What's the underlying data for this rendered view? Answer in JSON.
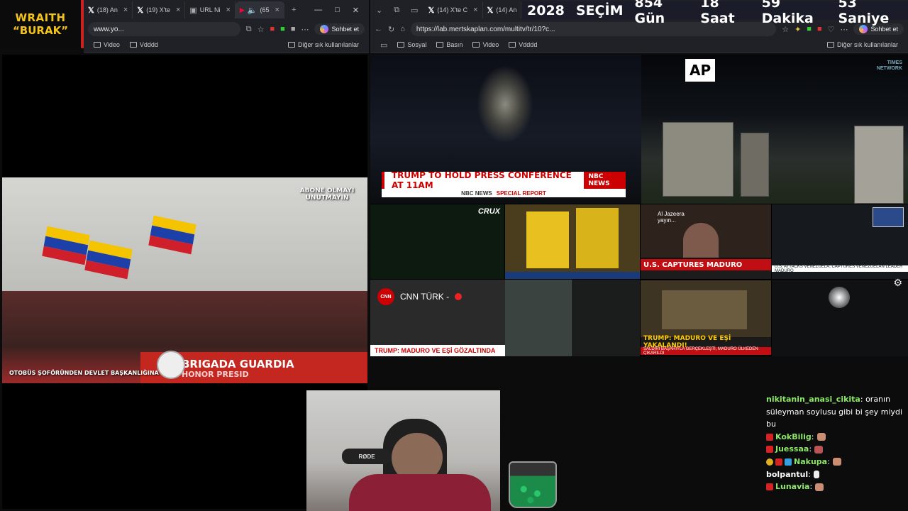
{
  "logo": {
    "line1": "WRAITH",
    "line2": "“BURAK”"
  },
  "left_browser": {
    "tabs": [
      {
        "label": "(18) An"
      },
      {
        "label": "(19) X'te"
      },
      {
        "label": "URL Ni"
      },
      {
        "label": "(65"
      }
    ],
    "url": "www.yo...",
    "copilot": "Sohbet et",
    "bookmarks": [
      "Video",
      "Vdddd"
    ],
    "bookmarks_other": "Diğer sık kullanılanlar"
  },
  "right_browser": {
    "tabs": [
      {
        "label": "(14) X'te C"
      },
      {
        "label": "(14) An"
      }
    ],
    "url": "https://lab.mertskaplan.com/multitv/tr/10?c...",
    "copilot": "Sohbet et",
    "bookmarks": [
      "Sosyal",
      "Basın",
      "Video",
      "Vdddd"
    ],
    "bookmarks_other": "Diğer sık kullanılanlar"
  },
  "countdown": [
    "2028",
    "SEÇİM",
    "854 Gün",
    "18 Saat",
    "59 Dakika",
    "53 Saniye"
  ],
  "left_video": {
    "subtitle_top": "ABONE OLMAYI UNUTMAYIN",
    "subtitle_bottom": "OTOBÜS ŞOFÖRÜNDEN DEVLET BAŞKANLIĞINA",
    "banner_line1": "BRIGADA GUARDIA",
    "banner_line2": "HONOR PRESID"
  },
  "grid": {
    "nbc_headline": "TRUMP TO HOLD PRESS CONFERENCE AT 11AM",
    "nbc_brand": "NBC NEWS",
    "nbc_strip": "NBC NEWS",
    "nbc_special": "SPECIAL REPORT",
    "ap_logo": "AP",
    "times_network": "TIMES NETWORK",
    "crux_label": "CRUX",
    "aj_caption": "Al Jazeera yayın...",
    "captures_headline": "U.S. CAPTURES MADURO",
    "venezuela_strip": "U.S. ATTACKS VENEZUELA, CAPTURES VENEZUELAN LEADER MADURO",
    "cnn_turk": "CNN TÜRK -",
    "cnn_turk_bar": "TRUMP: MADURO VE EŞİ GÖZALTINDA",
    "sozcu_headline": "TRUMP: MADURO VE EŞİ YAKALANDI!",
    "sozcu_sub": "SALDIRI BAŞARIYLA GERÇEKLEŞTİ, MADURO ÜLKEDEN ÇIKARILDI"
  },
  "webcam": {
    "mic_label": "RØDE"
  },
  "chat": [
    {
      "user": "nikitanin_anasi_cikita",
      "text": "oranın süleyman soylusu gibi bi şey miydi bu",
      "badges": []
    },
    {
      "user": "KokBilig",
      "text": "",
      "badges": [
        "red"
      ]
    },
    {
      "user": "Juessaa",
      "text": "",
      "badges": [
        "red"
      ]
    },
    {
      "user": "Nakupa",
      "text": "",
      "badges": [
        "gold",
        "red",
        "blue"
      ]
    },
    {
      "user": "bolpantul",
      "text": "",
      "badges": []
    },
    {
      "user": "Lunavia",
      "text": "",
      "badges": [
        "red"
      ]
    }
  ],
  "colors": {
    "accent_red": "#c10e12",
    "chat_user": "#8de86a",
    "logo_yellow": "#f4c419"
  }
}
